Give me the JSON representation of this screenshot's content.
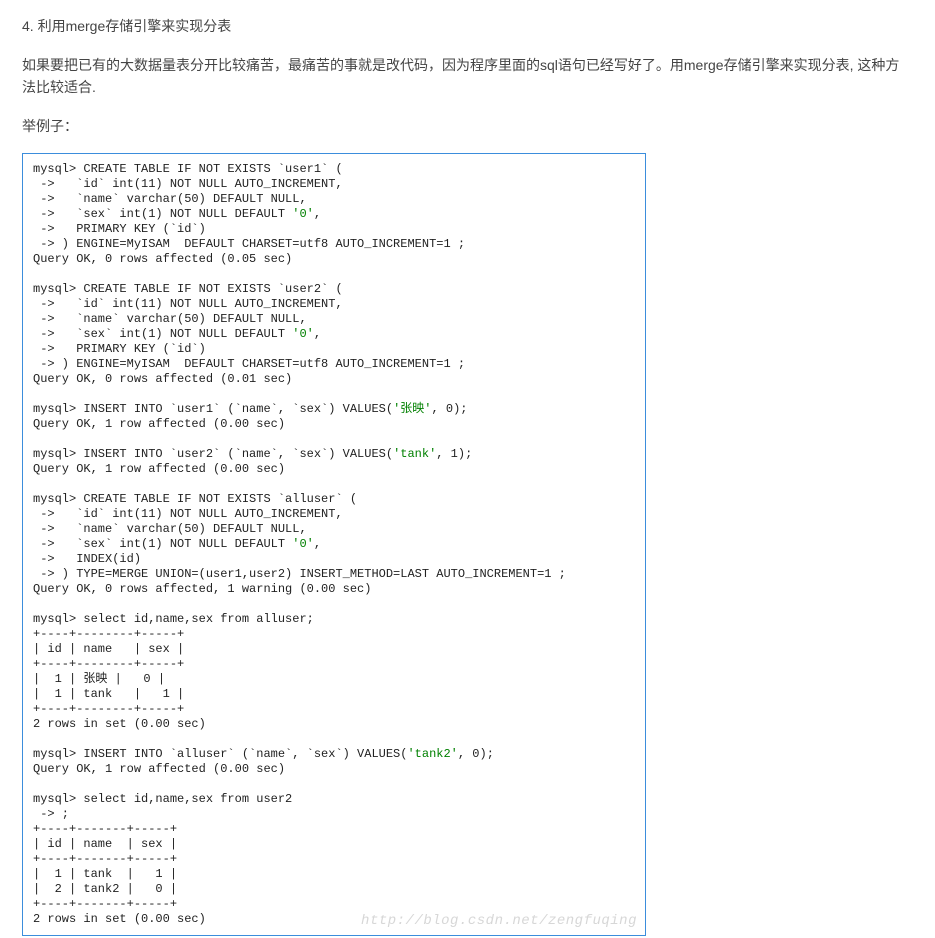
{
  "heading": "4. 利用merge存储引擎来实现分表",
  "para1": "如果要把已有的大数据量表分开比较痛苦，最痛苦的事就是改代码，因为程序里面的sql语句已经写好了。用merge存储引擎来实现分表, 这种方法比较适合.",
  "para2": "举例子：",
  "watermark": "http://blog.csdn.net/zengfuqing",
  "code": {
    "l01": "mysql> CREATE TABLE IF NOT EXISTS `user1` (",
    "l02": " ->   `id` int(11) NOT NULL AUTO_INCREMENT,",
    "l03": " ->   `name` varchar(50) DEFAULT NULL,",
    "l04a": " ->   `sex` int(1) NOT NULL DEFAULT ",
    "l04v": "'0'",
    "l04b": ",",
    "l05": " ->   PRIMARY KEY (`id`)",
    "l06": " -> ) ENGINE=MyISAM  DEFAULT CHARSET=utf8 AUTO_INCREMENT=1 ;",
    "l07": "Query OK, 0 rows affected (0.05 sec)",
    "blank1": "",
    "l08": "mysql> CREATE TABLE IF NOT EXISTS `user2` (",
    "l09": " ->   `id` int(11) NOT NULL AUTO_INCREMENT,",
    "l10": " ->   `name` varchar(50) DEFAULT NULL,",
    "l11a": " ->   `sex` int(1) NOT NULL DEFAULT ",
    "l11v": "'0'",
    "l11b": ",",
    "l12": " ->   PRIMARY KEY (`id`)",
    "l13": " -> ) ENGINE=MyISAM  DEFAULT CHARSET=utf8 AUTO_INCREMENT=1 ;",
    "l14": "Query OK, 0 rows affected (0.01 sec)",
    "blank2": "",
    "l15a": "mysql> INSERT INTO `user1` (`name`, `sex`) VALUES(",
    "l15v": "'张映'",
    "l15b": ", 0);",
    "l16": "Query OK, 1 row affected (0.00 sec)",
    "blank3": "",
    "l17a": "mysql> INSERT INTO `user2` (`name`, `sex`) VALUES(",
    "l17v": "'tank'",
    "l17b": ", 1);",
    "l18": "Query OK, 1 row affected (0.00 sec)",
    "blank4": "",
    "l19": "mysql> CREATE TABLE IF NOT EXISTS `alluser` (",
    "l20": " ->   `id` int(11) NOT NULL AUTO_INCREMENT,",
    "l21": " ->   `name` varchar(50) DEFAULT NULL,",
    "l22a": " ->   `sex` int(1) NOT NULL DEFAULT ",
    "l22v": "'0'",
    "l22b": ",",
    "l23": " ->   INDEX(id)",
    "l24": " -> ) TYPE=MERGE UNION=(user1,user2) INSERT_METHOD=LAST AUTO_INCREMENT=1 ;",
    "l25": "Query OK, 0 rows affected, 1 warning (0.00 sec)",
    "blank5": "",
    "l26": "mysql> select id,name,sex from alluser;",
    "l27": "+----+--------+-----+",
    "l28": "| id | name   | sex |",
    "l29": "+----+--------+-----+",
    "l30": "|  1 | 张映 |   0 |",
    "l31": "|  1 | tank   |   1 |",
    "l32": "+----+--------+-----+",
    "l33": "2 rows in set (0.00 sec)",
    "blank6": "",
    "l34a": "mysql> INSERT INTO `alluser` (`name`, `sex`) VALUES(",
    "l34v": "'tank2'",
    "l34b": ", 0);",
    "l35": "Query OK, 1 row affected (0.00 sec)",
    "blank7": "",
    "l36": "mysql> select id,name,sex from user2",
    "l37": " -> ;",
    "l38": "+----+-------+-----+",
    "l39": "| id | name  | sex |",
    "l40": "+----+-------+-----+",
    "l41": "|  1 | tank  |   1 |",
    "l42": "|  2 | tank2 |   0 |",
    "l43": "+----+-------+-----+",
    "l44": "2 rows in set (0.00 sec)"
  }
}
